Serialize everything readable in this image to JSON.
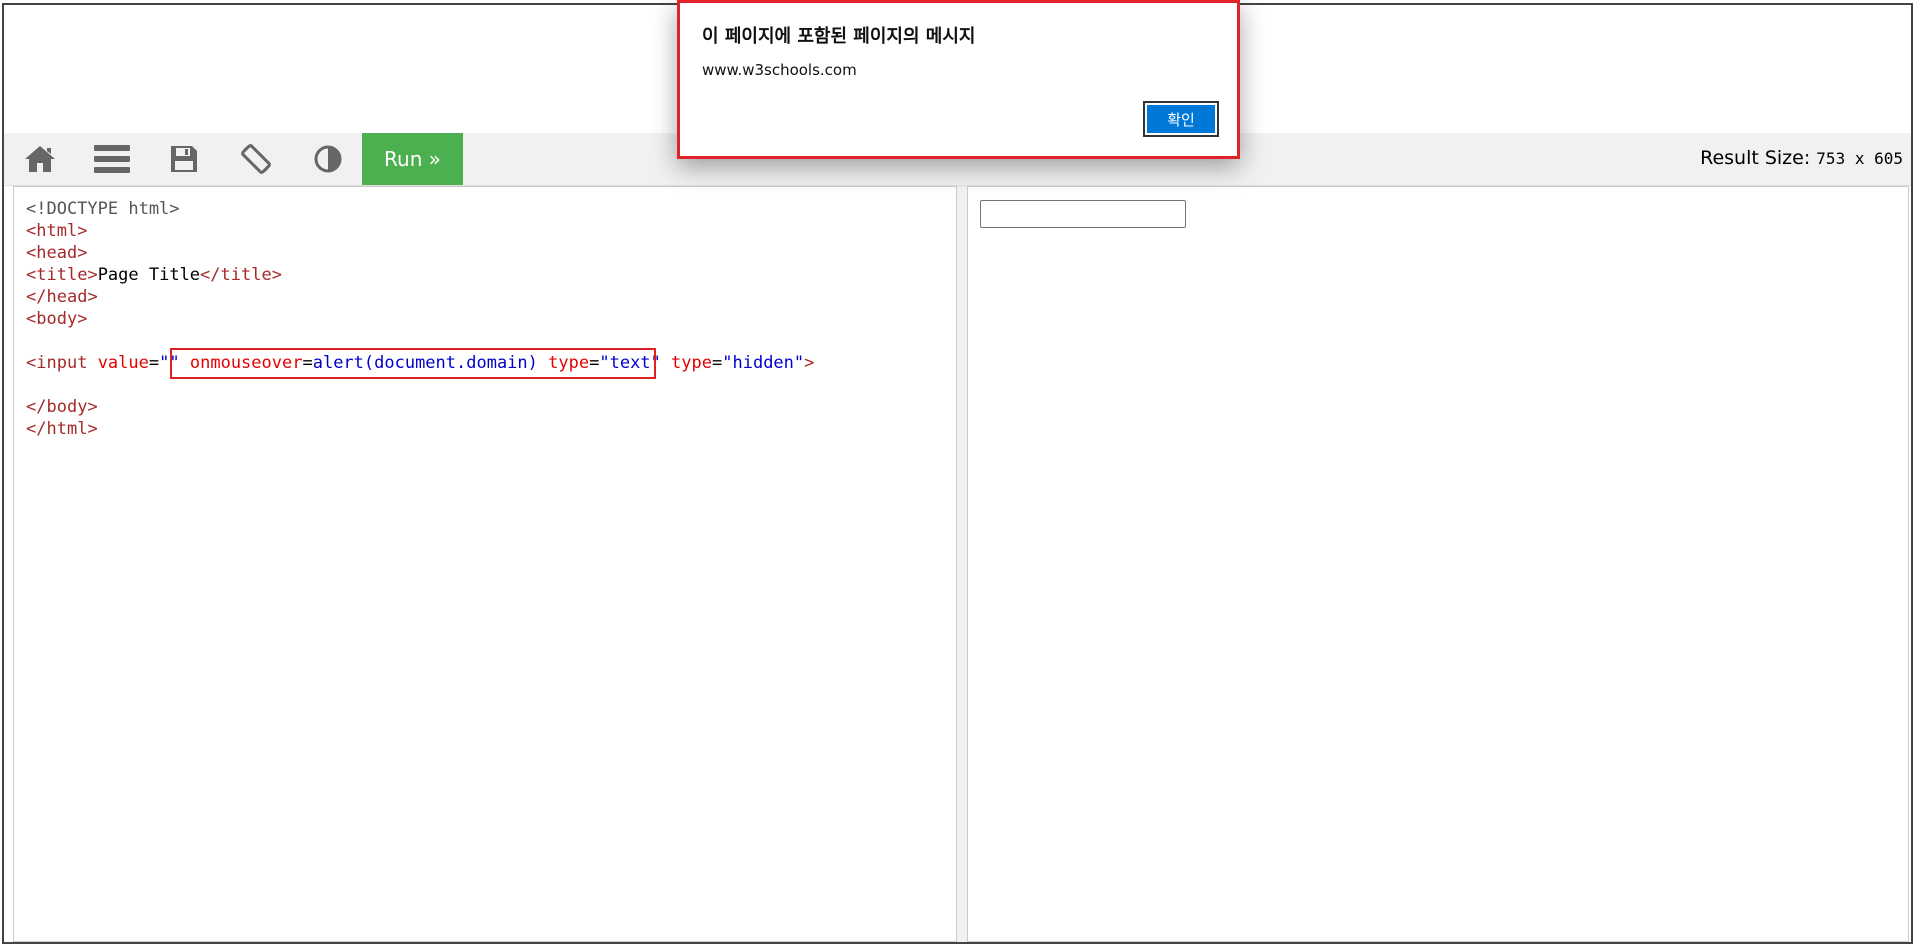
{
  "toolbar": {
    "icons": [
      "home-icon",
      "menu-icon",
      "save-icon",
      "rotate-icon",
      "contrast-icon"
    ],
    "run_label": "Run »",
    "result_size_label": "Result Size:",
    "result_size_value": "753 x 605",
    "run_color": "#4caf50"
  },
  "editor": {
    "lines": {
      "l1": "<!DOCTYPE html>",
      "l2_open": "<",
      "l2_tag": "html",
      "l2_close": ">",
      "l3_tag": "head",
      "l4_tag_open": "title",
      "l4_text": "Page Title",
      "l4_tag_close": "title",
      "l5_tag": "head",
      "l6_tag": "body",
      "l7_tag": "input",
      "l7_attr1": "value",
      "l7_val1a": "\"",
      "l7_val1b": "\"",
      "l7_attr2": "onmouseover",
      "l7_val2": "alert(document.domain)",
      "l7_attr3": "type",
      "l7_val3a": "\"",
      "l7_val3b": "text",
      "l7_val3c": "\"",
      "l7_attr4": "type",
      "l7_val4": "\"hidden\"",
      "l8_tag": "body",
      "l9_tag": "html"
    },
    "highlight_color": "#e02020"
  },
  "dialog": {
    "title": "이 페이지에 포함된 페이지의 메시지",
    "message": "www.w3schools.com",
    "ok_label": "확인",
    "accent": "#0078d7",
    "border_color": "#e0222a"
  }
}
